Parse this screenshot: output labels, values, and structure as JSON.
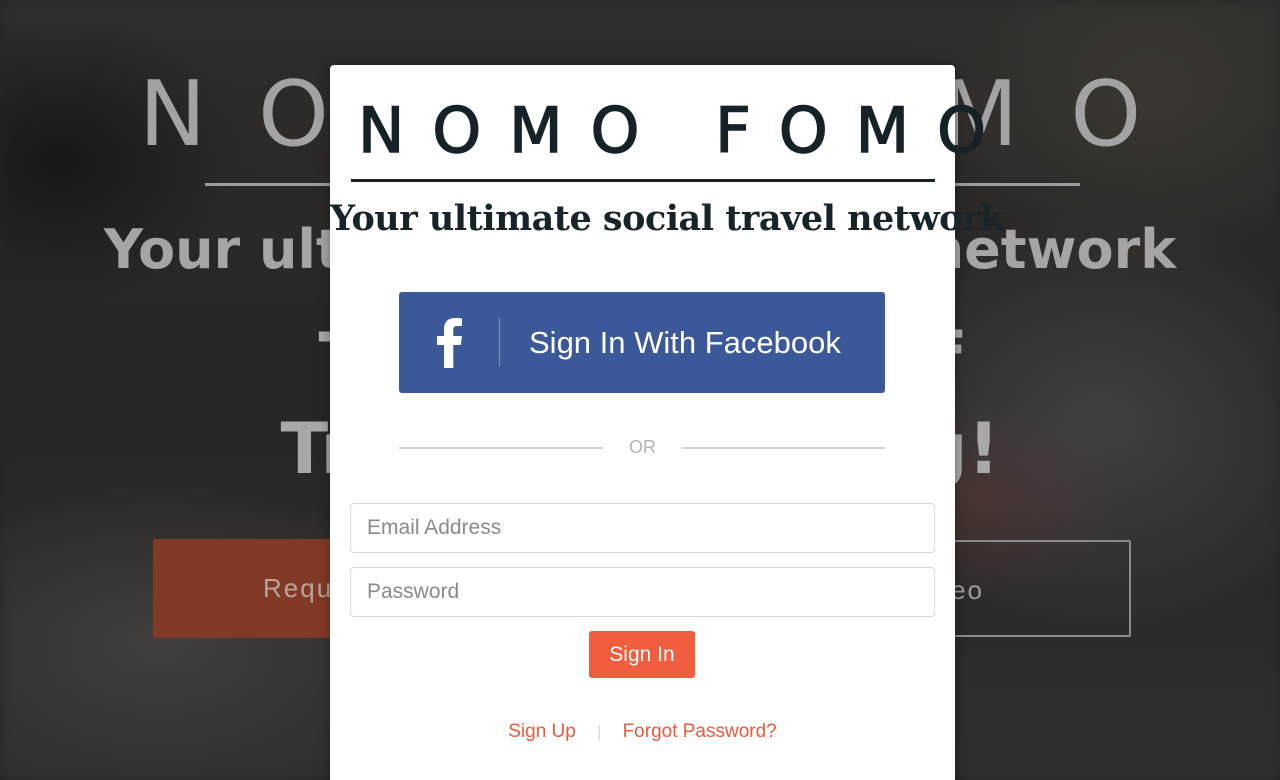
{
  "background": {
    "brand": "NOMO FOMO",
    "tagline": "Your ultimate social travel network",
    "headline_line1": "The Evolution of",
    "headline_line2": "Travel Socializing!",
    "cta_left_label": "Request",
    "cta_right_label": "Video"
  },
  "modal": {
    "logo": "NOMO FOMO",
    "tagline": "Your ultimate social travel network",
    "facebook_button": {
      "label": "Sign In With Facebook",
      "icon": "facebook-f-icon",
      "color": "#3b5998"
    },
    "divider_label": "OR",
    "email": {
      "value": "",
      "placeholder": "Email Address"
    },
    "password": {
      "value": "",
      "placeholder": "Password"
    },
    "signin_button": {
      "label": "Sign In",
      "color": "#f15d3f"
    },
    "links": {
      "signup": "Sign Up",
      "separator": "|",
      "forgot": "Forgot Password?"
    }
  }
}
